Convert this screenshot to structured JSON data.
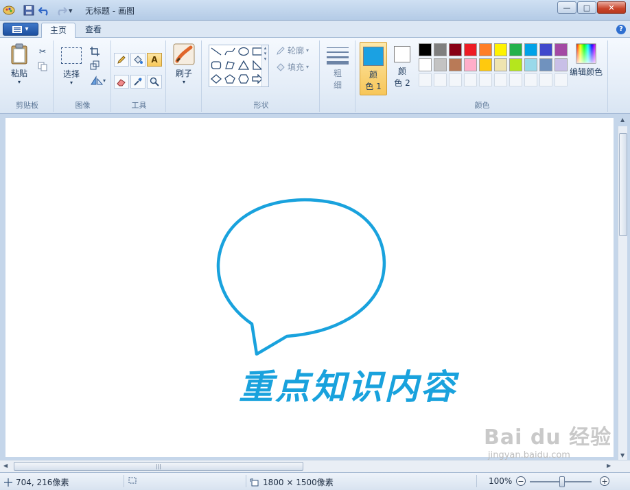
{
  "window": {
    "title": "无标题 - 画图",
    "minimize_label": "—",
    "maximize_label": "□",
    "close_label": "✕"
  },
  "quick_access": {
    "dropdown_glyph": "▾"
  },
  "tabs": [
    {
      "label": "主页",
      "active": true
    },
    {
      "label": "查看",
      "active": false
    }
  ],
  "help_glyph": "?",
  "ribbon": {
    "clipboard": {
      "label": "剪贴板",
      "paste_label": "粘贴"
    },
    "image": {
      "label": "图像",
      "select_label": "选择"
    },
    "tools": {
      "label": "工具",
      "text_tool_glyph": "A"
    },
    "brushes": {
      "label": "刷子"
    },
    "shapes": {
      "label": "形状",
      "outline_label": "轮廓",
      "fill_label": "填充"
    },
    "size": {
      "label_line1": "粗",
      "label_line2": "细"
    },
    "colors": {
      "label": "颜色",
      "color1_label_line1": "颜",
      "color1_label_line2": "色 1",
      "color2_label_line1": "颜",
      "color2_label_line2": "色 2",
      "color1_value": "#1ba1e2",
      "color2_value": "#ffffff",
      "edit_label": "编辑颜色",
      "palette_row1": [
        "#000000",
        "#7f7f7f",
        "#880015",
        "#ed1c24",
        "#ff7f27",
        "#fff200",
        "#22b14c",
        "#00a2e8",
        "#3f48cc",
        "#a349a4"
      ],
      "palette_row2": [
        "#ffffff",
        "#c3c3c3",
        "#b97a57",
        "#ffaec9",
        "#ffc90e",
        "#efe4b0",
        "#b5e61d",
        "#99d9ea",
        "#7092be",
        "#c8bfe7"
      ]
    }
  },
  "canvas": {
    "text": "重点知识内容",
    "stroke_color": "#19a2dd"
  },
  "statusbar": {
    "cursor_pos": "704, 216像素",
    "canvas_size": "1800 × 1500像素",
    "zoom_level": "100%",
    "zoom_out_glyph": "−",
    "zoom_in_glyph": "+"
  },
  "watermark": {
    "brand": "Bai du 经验",
    "url": "jingyan.baidu.com"
  }
}
